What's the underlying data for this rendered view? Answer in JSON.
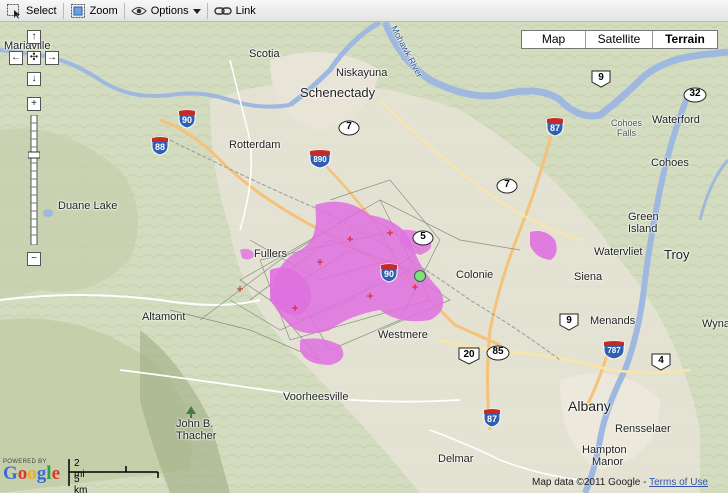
{
  "toolbar": {
    "select_label": "Select",
    "zoom_label": "Zoom",
    "options_label": "Options",
    "link_label": "Link"
  },
  "map_types": {
    "map": "Map",
    "satellite": "Satellite",
    "terrain": "Terrain",
    "active": "Terrain"
  },
  "places": {
    "scotia": "Scotia",
    "niskayuna": "Niskayuna",
    "schenectady": "Schenectady",
    "mariaville": "Mariaville",
    "rotterdam": "Rotterdam",
    "duane_lake": "Duane Lake",
    "fullers": "Fullers",
    "colonie": "Colonie",
    "altamont": "Altamont",
    "westmere": "Westmere",
    "voorheesville": "Voorheesville",
    "john_b_thacher_1": "John B.",
    "john_b_thacher_2": "Thacher",
    "delmar": "Delmar",
    "albany": "Albany",
    "rensselaer": "Rensselaer",
    "hampton_manor_1": "Hampton",
    "hampton_manor_2": "Manor",
    "waterford": "Waterford",
    "cohoes": "Cohoes",
    "cohoes_falls_1": "Cohoes",
    "cohoes_falls_2": "Falls",
    "green_island_1": "Green",
    "green_island_2": "Island",
    "troy": "Troy",
    "watervliet": "Watervliet",
    "siena": "Siena",
    "menands": "Menands",
    "wyna": "Wyna",
    "mohawk_river": "Mohawk River"
  },
  "shields": {
    "i90_a": "90",
    "i88": "88",
    "i890": "890",
    "i87_a": "87",
    "i90_b": "90",
    "i87_b": "87",
    "i787": "787",
    "r7_a": "7",
    "r7_b": "7",
    "r5": "5",
    "r9_a": "9",
    "r9_b": "9",
    "r32": "32",
    "r20": "20",
    "r85": "85",
    "r4": "4"
  },
  "footer": {
    "powered_by": "POWERED BY",
    "google": "Google",
    "scale_mi": "2 mi",
    "scale_km": "5 km",
    "map_data": "Map data ©2011 Google -",
    "terms": "Terms of Use"
  },
  "colors": {
    "track": "#e070e0",
    "marker": "#7fe07f",
    "water": "#9fb8e0",
    "urban": "#e8e4d8",
    "terrain": "#d4dcc0"
  },
  "icons": {
    "select": "select-icon",
    "zoom": "zoom-icon",
    "options": "eye-icon",
    "link": "link-icon"
  }
}
